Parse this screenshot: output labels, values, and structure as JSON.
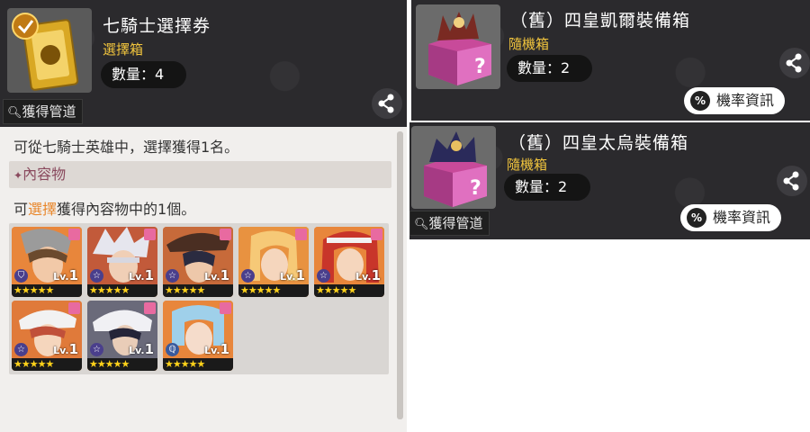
{
  "ticket": {
    "title": "七騎士選擇券",
    "type": "選擇箱",
    "quantity": "數量：4",
    "source_button": "獲得管道"
  },
  "info": {
    "description": "可從七騎士英雄中，選擇獲得1名。",
    "section_title": "內容物",
    "select_prefix": "可",
    "select_highlight": "選擇",
    "select_suffix": "獲得內容物中的1個。"
  },
  "heroes": [
    {
      "level_prefix": "Lv.",
      "level": "1",
      "stars": "★★★★★",
      "class_icon": "shield-icon"
    },
    {
      "level_prefix": "Lv.",
      "level": "1",
      "stars": "★★★★★",
      "class_icon": "star-icon"
    },
    {
      "level_prefix": "Lv.",
      "level": "1",
      "stars": "★★★★★",
      "class_icon": "star-icon"
    },
    {
      "level_prefix": "Lv.",
      "level": "1",
      "stars": "★★★★★",
      "class_icon": "star-icon"
    },
    {
      "level_prefix": "Lv.",
      "level": "1",
      "stars": "★★★★★",
      "class_icon": "star-icon"
    },
    {
      "level_prefix": "Lv.",
      "level": "1",
      "stars": "★★★★★",
      "class_icon": "star-icon"
    },
    {
      "level_prefix": "Lv.",
      "level": "1",
      "stars": "★★★★★",
      "class_icon": "star-icon"
    },
    {
      "level_prefix": "Lv.",
      "level": "1",
      "stars": "★★★★★",
      "class_icon": "magic-icon"
    }
  ],
  "box1": {
    "title": "（舊）四皇凱爾裝備箱",
    "type": "隨機箱",
    "quantity": "數量：2",
    "prob_button": "機率資訊",
    "prob_icon": "%"
  },
  "box2": {
    "title": "（舊）四皇太烏裝備箱",
    "type": "隨機箱",
    "quantity": "數量：2",
    "prob_button": "機率資訊",
    "prob_icon": "%",
    "source_button": "獲得管道"
  },
  "colors": {
    "panel_bg": "#2b2a2d",
    "accent_gold": "#f2c53d",
    "highlight_orange": "#e8862a",
    "section_text": "#8a4a5e"
  }
}
